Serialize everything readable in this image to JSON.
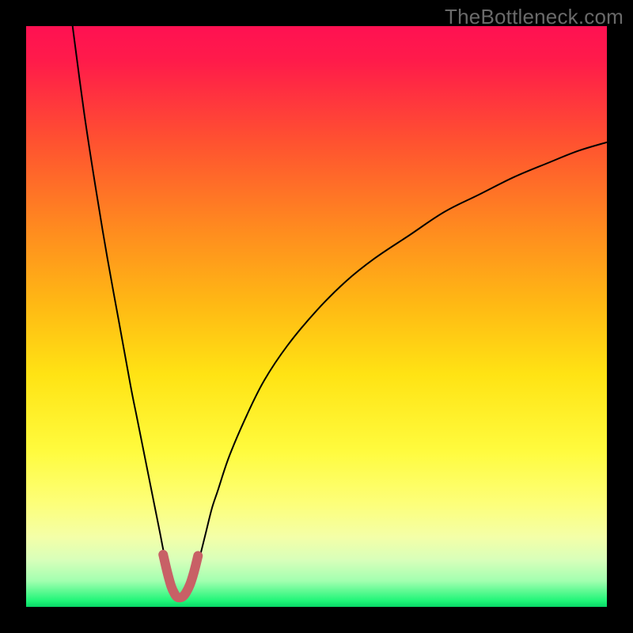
{
  "watermark": "TheBottleneck.com",
  "chart_data": {
    "type": "line",
    "title": "",
    "xlabel": "",
    "ylabel": "",
    "xlim": [
      0,
      100
    ],
    "ylim": [
      0,
      100
    ],
    "background_gradient_stops": [
      {
        "offset": 0,
        "color": "#ff1152"
      },
      {
        "offset": 0.06,
        "color": "#ff1b4a"
      },
      {
        "offset": 0.2,
        "color": "#ff5230"
      },
      {
        "offset": 0.35,
        "color": "#ff8b1f"
      },
      {
        "offset": 0.48,
        "color": "#ffb914"
      },
      {
        "offset": 0.6,
        "color": "#ffe314"
      },
      {
        "offset": 0.73,
        "color": "#fffb3d"
      },
      {
        "offset": 0.82,
        "color": "#fdff78"
      },
      {
        "offset": 0.88,
        "color": "#f4ffa8"
      },
      {
        "offset": 0.92,
        "color": "#d7ffba"
      },
      {
        "offset": 0.955,
        "color": "#a3ffb0"
      },
      {
        "offset": 0.99,
        "color": "#1ef577"
      },
      {
        "offset": 1.0,
        "color": "#08d767"
      }
    ],
    "series": [
      {
        "name": "curve",
        "color": "#000000",
        "stroke_width": 2,
        "x": [
          8,
          10,
          12,
          14,
          16,
          18,
          19,
          20,
          21,
          22,
          23,
          24,
          25,
          25.8,
          26.5,
          27.2,
          28,
          28.8,
          29.4,
          30,
          31,
          32,
          33,
          35,
          38,
          41,
          45,
          50,
          55,
          60,
          66,
          72,
          78,
          84,
          90,
          95,
          100
        ],
        "y": [
          100,
          85,
          72,
          60,
          49,
          38,
          33,
          28,
          23,
          18,
          13,
          8,
          4.5,
          2.5,
          1.5,
          1.5,
          2.5,
          4.5,
          7,
          9,
          13,
          17,
          20,
          26,
          33,
          39,
          45,
          51,
          56,
          60,
          64,
          68,
          71,
          74,
          76.5,
          78.5,
          80
        ]
      },
      {
        "name": "highlight-valley",
        "color": "#c86066",
        "stroke_width": 12,
        "x": [
          23.6,
          24.3,
          25,
          25.6,
          26,
          26.5,
          27,
          27.5,
          28.2,
          28.9,
          29.6
        ],
        "y": [
          9,
          6,
          3.5,
          2.2,
          1.7,
          1.6,
          1.8,
          2.4,
          3.8,
          6,
          8.8
        ]
      }
    ]
  }
}
